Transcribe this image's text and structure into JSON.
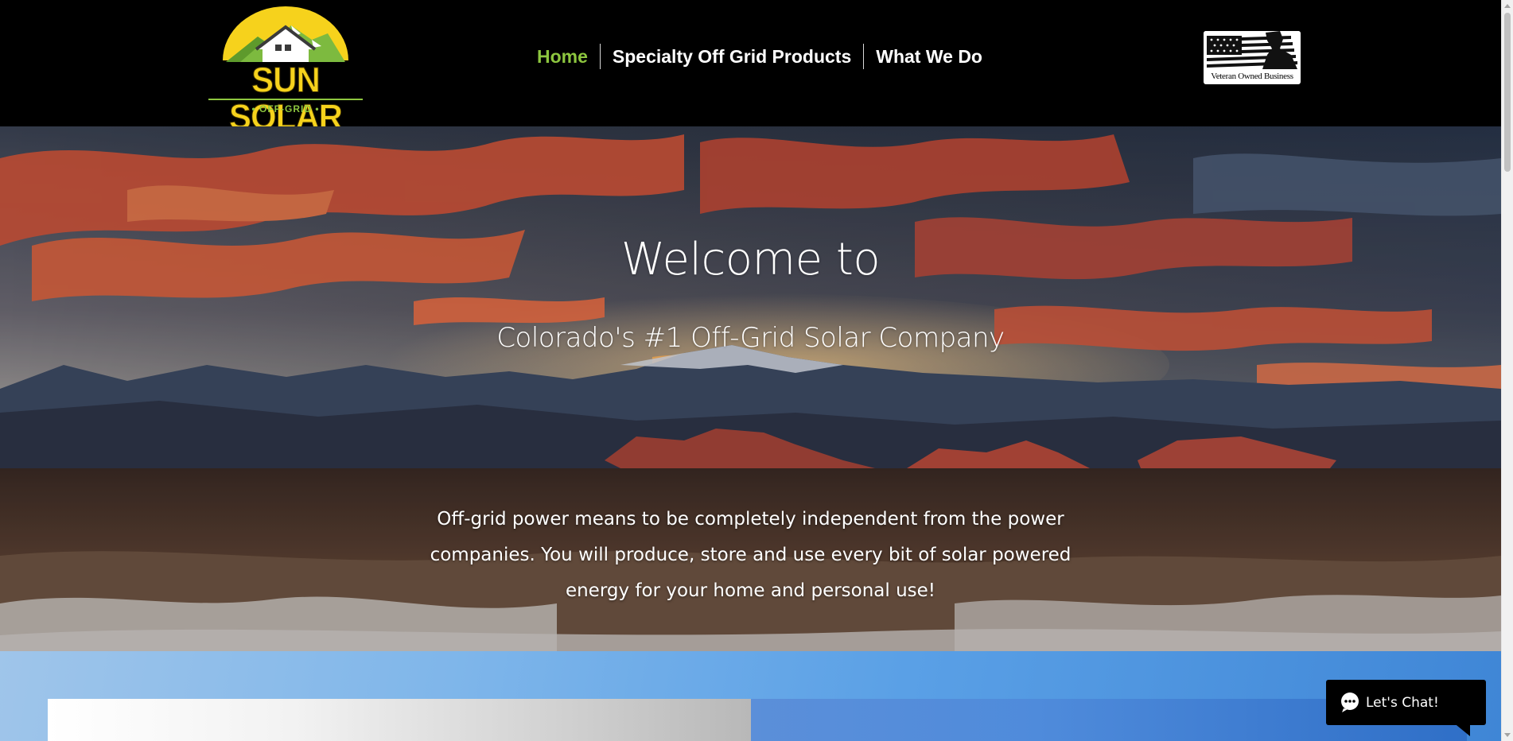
{
  "header": {
    "logo": {
      "name": "SUN SOLAR",
      "tagline": "• OFF-GRID •"
    },
    "nav": [
      {
        "label": "Home",
        "active": true
      },
      {
        "label": "Specialty Off Grid Products",
        "active": false
      },
      {
        "label": "What We Do",
        "active": false
      }
    ],
    "badge": {
      "text": "Veteran Owned Business"
    }
  },
  "hero": {
    "title": "Welcome to",
    "subtitle": "Colorado's #1 Off-Grid Solar Company",
    "body": "Off-grid power means to be completely independent from the power companies. You will produce, store and use every bit of solar powered energy for your home and personal use!"
  },
  "chat": {
    "label": "Let's Chat!",
    "icon": "chat-bubble-icon"
  },
  "colors": {
    "nav_active": "#8dc63f",
    "nav_text": "#ffffff",
    "header_bg": "#000000",
    "logo_yellow": "#f6d21c"
  }
}
